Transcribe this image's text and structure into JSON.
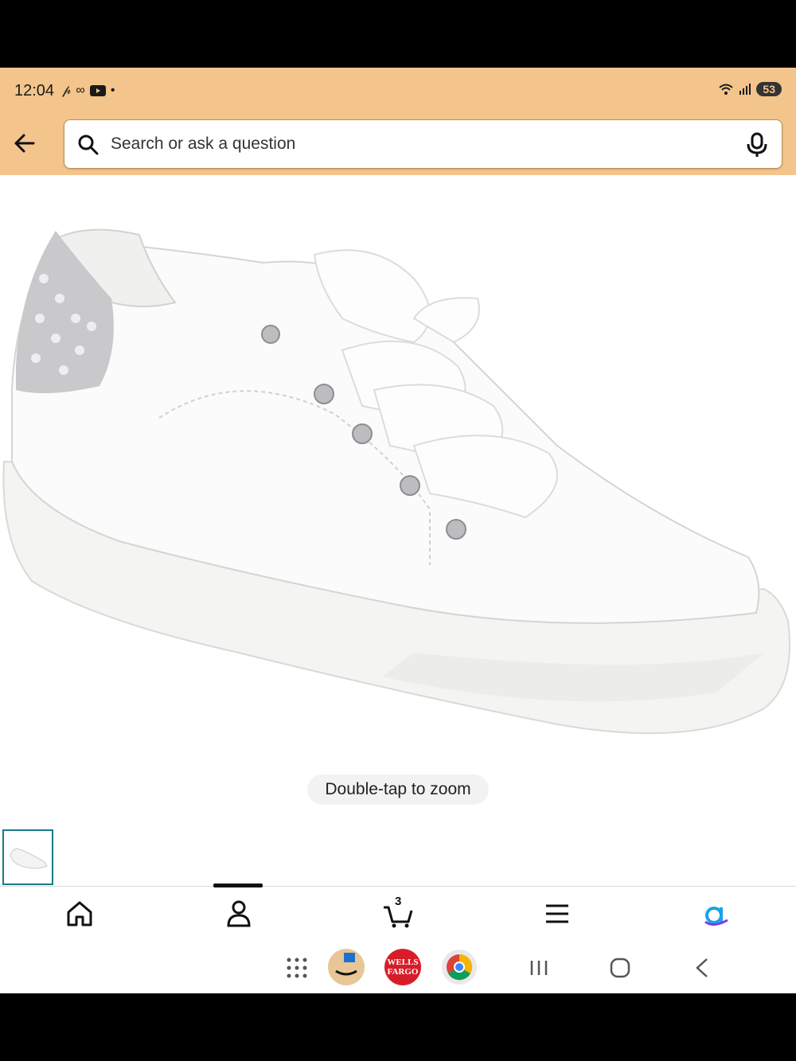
{
  "status_bar": {
    "time": "12:04",
    "battery": "53",
    "icons": [
      "link-icon",
      "voicemail-icon",
      "youtube-icon",
      "dot-icon",
      "wifi-icon",
      "signal-icon",
      "battery-icon"
    ]
  },
  "search": {
    "placeholder": "Search or ask a question"
  },
  "product": {
    "zoom_hint": "Double-tap to zoom"
  },
  "bottom_nav": {
    "items": [
      "home-icon",
      "account-icon",
      "cart-icon",
      "menu-icon",
      "rufus-icon"
    ],
    "cart_count": "3",
    "active_index": 1
  },
  "android_nav": {
    "apps": [
      "app-drawer-icon",
      "amazon-app-icon",
      "wells-fargo-app-icon",
      "chrome-app-icon"
    ],
    "wells_fargo_label_1": "WELLS",
    "wells_fargo_label_2": "FARGO",
    "buttons": [
      "recents-button",
      "home-button",
      "back-button"
    ]
  },
  "colors": {
    "header": "#f3c48b",
    "thumb_border": "#1a7a86",
    "rufus_accent": "#1aa3e8",
    "wells_fargo": "#d71e28"
  }
}
